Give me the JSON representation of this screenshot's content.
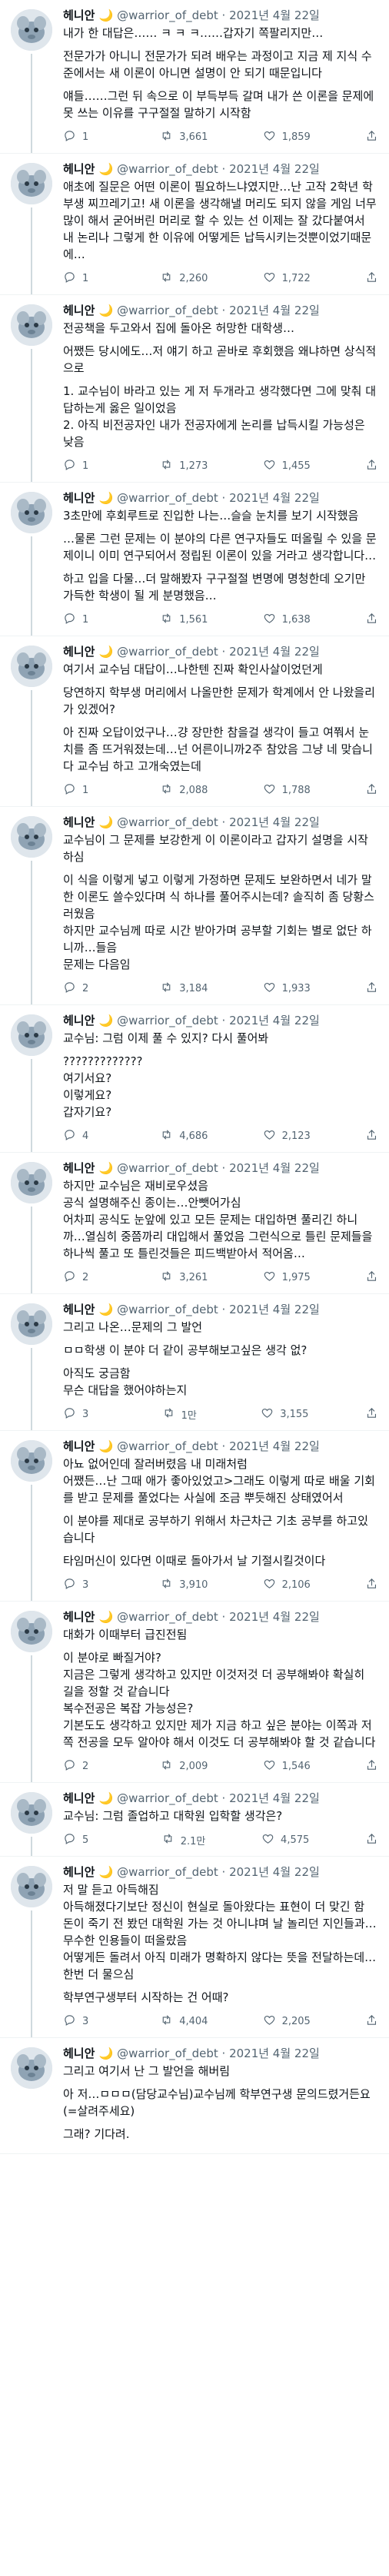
{
  "tweets": [
    {
      "name": "헤니안 🌙",
      "handle": "@warrior_of_debt",
      "date": "2021년 4월 22일",
      "paragraphs": [
        "내가 한 대답은…… ㅋ ㅋ ㅋ……갑자기 쪽팔리지만…",
        "전문가가 아니니 전문가가 되려 배우는 과정이고 지금 제 지식 수준에서는 새 이론이 아니면 설명이 안 되기 때문입니다",
        "얘들……그런 뒤 속으로 이 부득부득 갈며 내가 쓴 이론을 문제에 못 쓰는 이유를 구구절절 말하기 시작함"
      ],
      "reply": "1",
      "retweet": "3,661",
      "like": "1,859"
    },
    {
      "name": "헤니안 🌙",
      "handle": "@warrior_of_debt",
      "date": "2021년 4월 22일",
      "paragraphs": [
        "애초에 질문은 어떤 이론이 필요하느냐였지만…난 고작 2학년 학부생 찌끄레기고! 새 이론을 생각해낼 머리도 되지 않을 게임 너무 많이 해서 굳어버린 머리로 할 수 있는 선 이제는 잘 갔다붙여서 내 논리나 그렇게 한 이유에 어떻게든 납득시키는것뿐이었기때문에…"
      ],
      "reply": "1",
      "retweet": "2,260",
      "like": "1,722"
    },
    {
      "name": "헤니안 🌙",
      "handle": "@warrior_of_debt",
      "date": "2021년 4월 22일",
      "paragraphs": [
        "전공책을 두고와서 집에 돌아온 허망한 대학생…",
        "어쨌든 당시에도…저 얘기 하고 곧바로 후회했음 왜냐하면 상식적으로",
        "1. 교수님이 바라고 있는 게 저 두개라고 생각했다면 그에 맞춰 대답하는게 옳은 일이었음\n2. 아직 비전공자인 내가 전공자에게 논리를 납득시킬 가능성은 낮음"
      ],
      "reply": "1",
      "retweet": "1,273",
      "like": "1,455"
    },
    {
      "name": "헤니안 🌙",
      "handle": "@warrior_of_debt",
      "date": "2021년 4월 22일",
      "paragraphs": [
        "3초만에 후회루트로 진입한 나는…슬슬 눈치를 보기 시작했음",
        "…물론 그런 문제는 이 분야의 다른 연구자들도 떠올릴 수 있을 문제이니 이미 연구되어서 정립된 이론이 있을 거라고 생각합니다…",
        "하고 입을 다물…더 말해봤자 구구절절 변명에 명청한데 오기만 가득한 학생이 될 게 분명했음…"
      ],
      "reply": "1",
      "retweet": "1,561",
      "like": "1,638"
    },
    {
      "name": "헤니안 🌙",
      "handle": "@warrior_of_debt",
      "date": "2021년 4월 22일",
      "paragraphs": [
        "여기서 교수님 대답이…나한텐 진짜 확인사살이었던게",
        "당연하지 학부생 머리에서 나올만한 문제가 학계에서 안 나왔을리가 있겠어?",
        "아 진짜 오답이었구나…걍 장만한 참을걸 생각이 들고 여쭤서 눈치를 좀 뜨거워졌는데…넌 어른이니까2주 참았음 그냥 네 맞습니다 교수님 하고 고개숙였는데"
      ],
      "reply": "1",
      "retweet": "2,088",
      "like": "1,788"
    },
    {
      "name": "헤니안 🌙",
      "handle": "@warrior_of_debt",
      "date": "2021년 4월 22일",
      "paragraphs": [
        "교수님이 그 문제를 보강한게 이 이론이라고 갑자기 설명을 시작하심",
        "이 식을 이렇게 넣고 이렇게 가정하면 문제도 보완하면서 네가 말한 이론도 쓸수있다며 식 하나를 풀어주시는데? 솔직히 좀 당황스러웠음\n하지만 교수님께 따로 시간 받아가며 공부할 기회는 별로 없단 하니까…들음\n문제는 다음임"
      ],
      "reply": "2",
      "retweet": "3,184",
      "like": "1,933"
    },
    {
      "name": "헤니안 🌙",
      "handle": "@warrior_of_debt",
      "date": "2021년 4월 22일",
      "paragraphs": [
        "교수님: 그럼 이제 풀 수 있지? 다시 풀어봐",
        "?????????????\n여기서요?\n이렇게요?\n갑자기요?"
      ],
      "reply": "4",
      "retweet": "4,686",
      "like": "2,123"
    },
    {
      "name": "헤니안 🌙",
      "handle": "@warrior_of_debt",
      "date": "2021년 4월 22일",
      "paragraphs": [
        "하지만 교수님은 재비로우셨음\n공식 설명해주신 종이는…안뺏어가심\n어차피 공식도 눈앞에 있고 모든 문제는 대입하면 풀리긴 하니까…열심히 중쯤까리 대입해서 풀었음 그런식으로 틀린 문제들을 하나씩 풀고 또 틀린것들은 피드백받아서 적어옴…"
      ],
      "reply": "2",
      "retweet": "3,261",
      "like": "1,975"
    },
    {
      "name": "헤니안 🌙",
      "handle": "@warrior_of_debt",
      "date": "2021년 4월 22일",
      "paragraphs": [
        "그리고 나온…문제의 그 발언",
        "ㅁㅁ학생 이 분야 더 같이 공부해보고싶은 생각 없?",
        "아직도 궁금함\n무슨 대답을 했어야하는지"
      ],
      "reply": "3",
      "retweet": "1만",
      "like": "3,155"
    },
    {
      "name": "헤니안 🌙",
      "handle": "@warrior_of_debt",
      "date": "2021년 4월 22일",
      "paragraphs": [
        "아뇨 없어인데 잘러버렸음 내 미래처럼\n어쨌든…난 그때 애가 좋아있었고>그래도 이렇게 따로 배울 기회를 받고 문제를 풀었다는 사실에 조금 뿌듯해진 상태였어서",
        "이 분야를 제대로 공부하기 위해서 차근차근 기초 공부를 하고있습니다",
        "타임머신이 있다면 이때로 돌아가서 날 기절시킬것이다"
      ],
      "reply": "3",
      "retweet": "3,910",
      "like": "2,106"
    },
    {
      "name": "헤니안 🌙",
      "handle": "@warrior_of_debt",
      "date": "2021년 4월 22일",
      "paragraphs": [
        "대화가 이때부터 급진전됨",
        "이 분야로 빠질거야?\n지금은 그렇게 생각하고 있지만 이것저것 더 공부해봐야 확실히 길을 정할 것 같습니다\n복수전공은 복잡 가능성은?\n기본도도 생각하고 있지만 제가 지금 하고 싶은 분야는 이쪽과 저쪽 전공을 모두 알아야 해서 이것도 더 공부해봐야 할 것 같습니다"
      ],
      "reply": "2",
      "retweet": "2,009",
      "like": "1,546"
    },
    {
      "name": "헤니안 🌙",
      "handle": "@warrior_of_debt",
      "date": "2021년 4월 22일",
      "paragraphs": [
        "교수님: 그럼 졸업하고 대학원 입학할 생각은?"
      ],
      "reply": "5",
      "retweet": "2.1만",
      "like": "4,575"
    },
    {
      "name": "헤니안 🌙",
      "handle": "@warrior_of_debt",
      "date": "2021년 4월 22일",
      "paragraphs": [
        "저 말 듣고 아득해짐\n아득해졌다기보단 정신이 현실로 돌아왔다는 표현이 더 맞긴 함\n돈이 죽기 전 봤던 대학원 가는 것 아니냐며 날 놀리던 지인들과…무수한 인용들이 떠올랐음\n어떻게든 돌려서 아직 미래가 명확하지 않다는 뜻을 전달하는데…한번 더 물으심",
        "학부연구생부터 시작하는 건 어때?"
      ],
      "reply": "3",
      "retweet": "4,404",
      "like": "2,205"
    },
    {
      "name": "헤니안 🌙",
      "handle": "@warrior_of_debt",
      "date": "2021년 4월 22일",
      "paragraphs": [
        "그리고 여기서 난 그 발언을 해버림",
        "아 저…ㅁㅁㅁ(담당교수님)교수님께 학부연구생 문의드렸거든요\n(=살려주세요)",
        "그래? 기다려."
      ],
      "reply": "",
      "retweet": "",
      "like": ""
    }
  ]
}
